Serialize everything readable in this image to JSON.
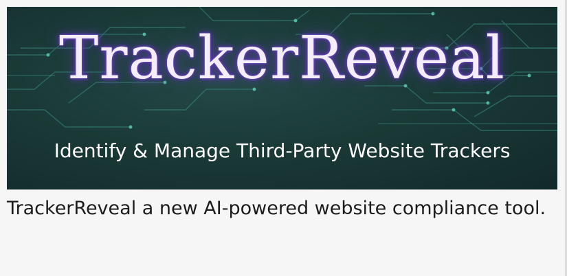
{
  "banner": {
    "title": "TrackerReveal",
    "tagline": "Identify & Manage Third-Party Website Trackers",
    "colors": {
      "background": "#1a3a37",
      "circuit_lines": "#3fa38f",
      "title_glow": "#6a3fc4",
      "title_text": "#f4eefc"
    },
    "icons": [
      "circuit-pattern"
    ]
  },
  "caption": {
    "text": "TrackerReveal a new AI-powered website compliance tool."
  }
}
